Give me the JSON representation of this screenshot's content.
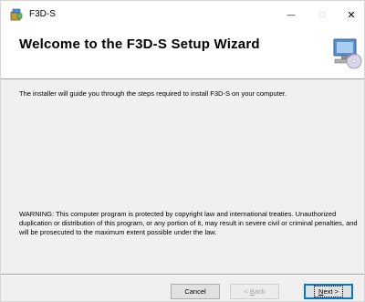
{
  "window": {
    "title": "F3D-S",
    "controls": {
      "minimize": "—",
      "maximize": "□",
      "close": "✕"
    }
  },
  "banner": {
    "title": "Welcome to the F3D-S Setup Wizard"
  },
  "content": {
    "intro": "The installer will guide you through the steps required to install F3D-S on your computer.",
    "warning": "WARNING: This computer program is protected by copyright law and international treaties. Unauthorized duplication or distribution of this program, or any portion of it, may result in severe civil or criminal penalties, and will be prosecuted to the maximum extent possible under the law."
  },
  "buttons": {
    "cancel": "Cancel",
    "back_prefix": "< ",
    "back_mnemonic": "B",
    "back_rest": "ack",
    "next_mnemonic": "N",
    "next_rest": "ext >"
  },
  "icons": {
    "app": "installer-box-icon",
    "banner": "computer-cd-icon"
  }
}
